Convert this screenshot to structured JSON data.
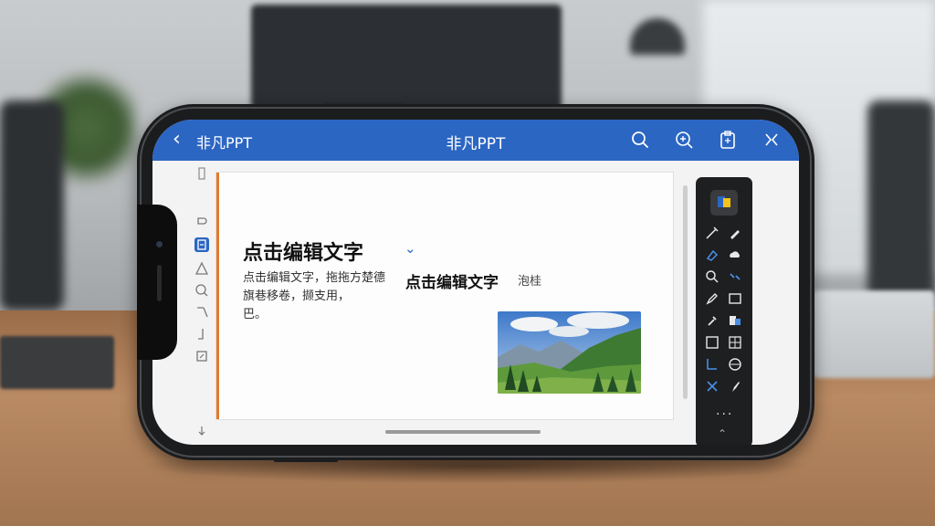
{
  "app": {
    "doc_name": "非凡PPT",
    "title": "非凡PPT"
  },
  "header_icons": [
    "back-icon",
    "search-icon",
    "comment-search-icon",
    "clipboard-icon",
    "close-panels-icon"
  ],
  "slide": {
    "heading": "点击编辑文字",
    "body_line1": "点击编辑文字，",
    "body_line1b": "拖拖方楚德",
    "overlay_text": "点击编辑文字",
    "body_tail": "泡桂",
    "body_line2": "旗巷移卷，撷支用，",
    "body_line3": "巴。"
  },
  "rail_icons": [
    "format-icon",
    "active-slide-icon",
    "triangle-icon",
    "search-icon",
    "pen-icon",
    "line-icon",
    "frame-icon",
    "scroll-down-icon"
  ],
  "toolbar": {
    "more_label": "···",
    "tools": [
      "pen-icon",
      "marker-icon",
      "eraser-icon",
      "cloud-icon",
      "search-icon",
      "link-icon",
      "pencil-icon",
      "rect-icon",
      "dropper-icon",
      "fill-icon",
      "square-icon",
      "grid-icon",
      "connector-icon",
      "circle-icon",
      "cross-icon",
      "brush-icon"
    ]
  },
  "colors": {
    "accent": "#2c66c3",
    "slide_border": "#e3782e",
    "toolbar_bg": "#1e1f21"
  }
}
